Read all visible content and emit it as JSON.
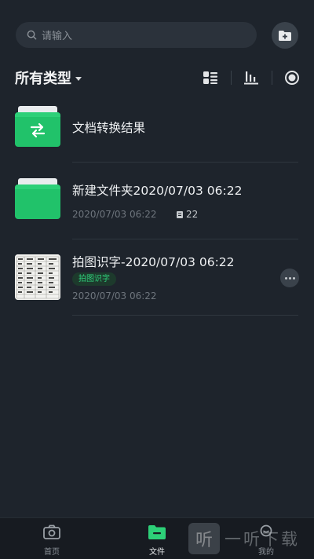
{
  "search": {
    "placeholder": "请输入"
  },
  "toolbar": {
    "filter_label": "所有类型"
  },
  "files": [
    {
      "title": "文档转换结果"
    },
    {
      "title": "新建文件夹2020/07/03 06:22",
      "date": "2020/07/03 06:22",
      "count": "22"
    },
    {
      "title": "拍图识字-2020/07/03 06:22",
      "tag": "拍图识字",
      "date": "2020/07/03 06:22"
    }
  ],
  "nav": [
    {
      "label": "首页",
      "icon": "camera-icon"
    },
    {
      "label": "文件",
      "icon": "folder-icon",
      "active": true
    },
    {
      "label": "我的",
      "icon": "user-icon"
    }
  ],
  "watermark": {
    "logo": "听",
    "text": "一听下载"
  },
  "colors": {
    "accent": "#21c26a",
    "background": "#1e242c"
  }
}
